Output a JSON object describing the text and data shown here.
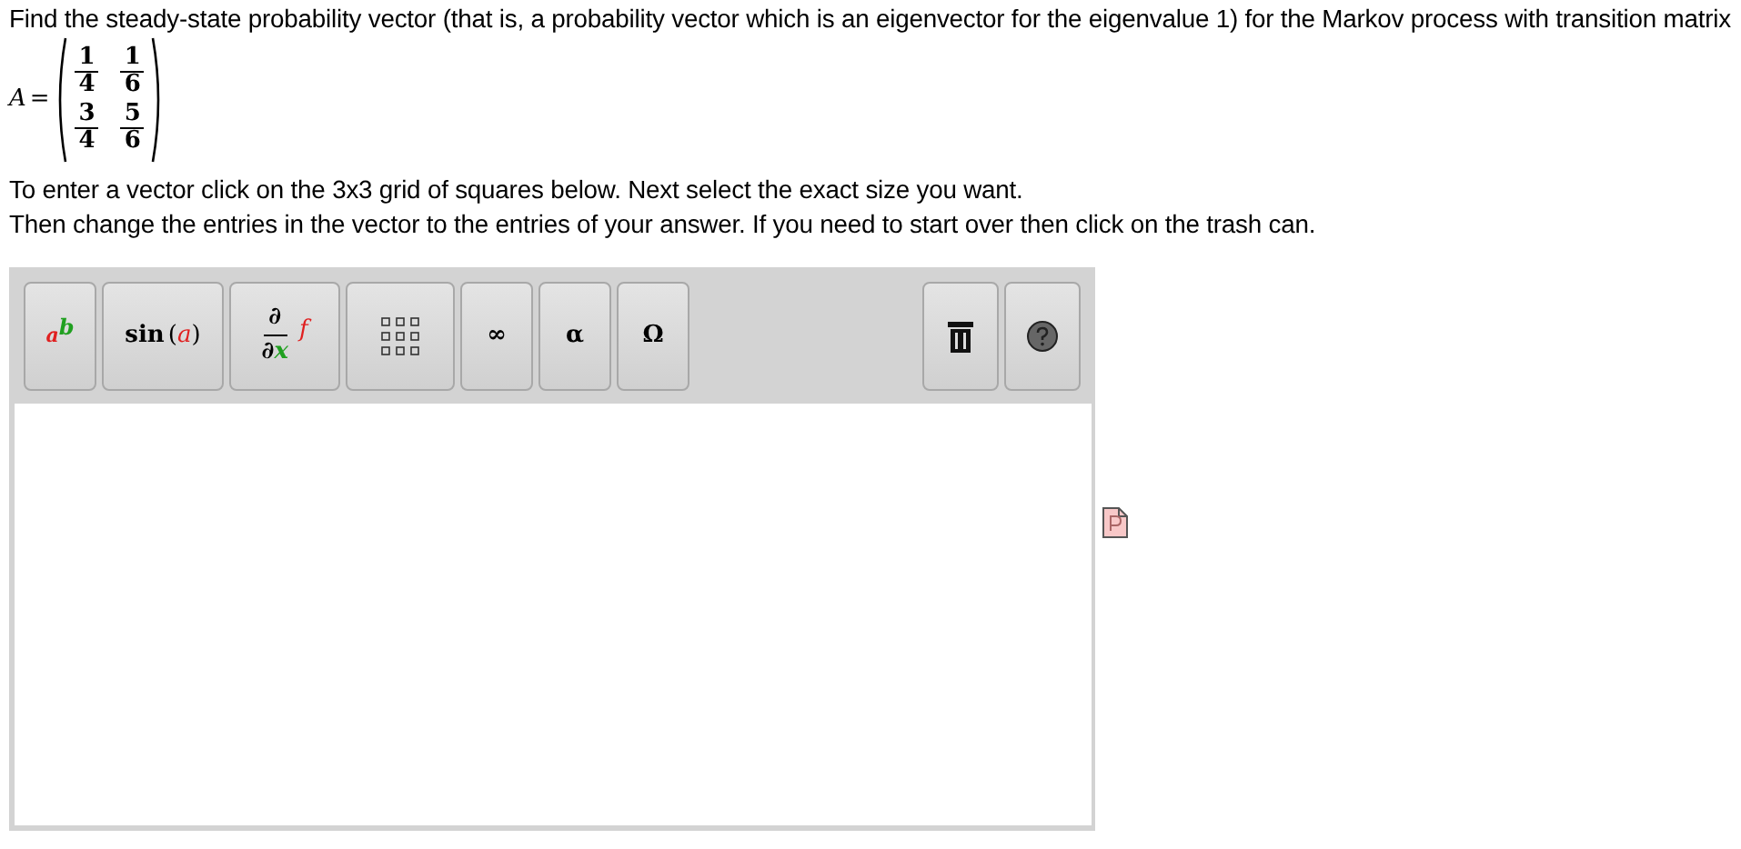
{
  "question": "Find the steady-state probability vector (that is, a probability vector which is an eigenvector for the eigenvalue 1) for the Markov process with transition matrix",
  "matrix": {
    "name": "A",
    "equals": "=",
    "rows": [
      [
        {
          "num": "1",
          "den": "4"
        },
        {
          "num": "1",
          "den": "6"
        }
      ],
      [
        {
          "num": "3",
          "den": "4"
        },
        {
          "num": "5",
          "den": "6"
        }
      ]
    ]
  },
  "instructions": [
    "To enter a vector click on the 3x3 grid of squares below. Next select the exact size you want.",
    "Then change the entries in the vector to the entries of your answer. If you need to start over then click on the trash can."
  ],
  "toolbar": [
    {
      "kind": "power",
      "base": "a",
      "exponent": "b"
    },
    {
      "kind": "function",
      "name": "sin",
      "open": "(",
      "arg": "a",
      "close": ")"
    },
    {
      "kind": "derivative",
      "top": "∂",
      "bottom": "∂",
      "variable": "x",
      "function": "f"
    },
    {
      "kind": "matrix"
    },
    {
      "kind": "symbol",
      "label": "∞"
    },
    {
      "kind": "symbol",
      "label": "α"
    },
    {
      "kind": "symbol",
      "label": "Ω"
    }
  ],
  "toolbar_right": [
    {
      "kind": "trash"
    },
    {
      "kind": "help"
    }
  ]
}
